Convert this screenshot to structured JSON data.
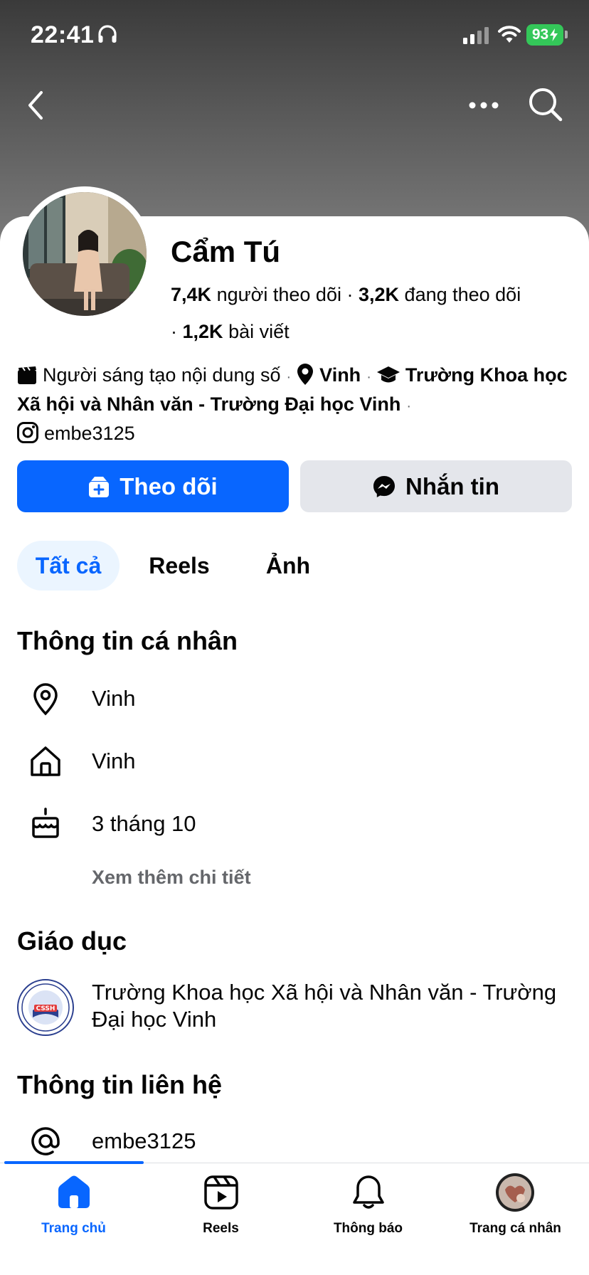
{
  "status_bar": {
    "time": "22:41",
    "battery": "93"
  },
  "header": {
    "back_icon": "chevron-left-icon",
    "more_icon": "more-horizontal-icon",
    "search_icon": "search-icon"
  },
  "profile": {
    "name": "Cẩm Tú",
    "followers_count": "7,4K",
    "followers_label": "người theo dõi",
    "following_count": "3,2K",
    "following_label": "đang theo dõi",
    "posts_count": "1,2K",
    "posts_label": "bài viết"
  },
  "intro": {
    "category": "Người sáng tạo nội dung số",
    "location": "Vinh",
    "school": "Trường Khoa học Xã hội và Nhân văn - Trường Đại học Vinh",
    "instagram": "embe3125"
  },
  "actions": {
    "follow_label": "Theo dõi",
    "message_label": "Nhắn tin"
  },
  "tabs": [
    {
      "label": "Tất cả",
      "active": true
    },
    {
      "label": "Reels",
      "active": false
    },
    {
      "label": "Ảnh",
      "active": false
    }
  ],
  "personal_info": {
    "title": "Thông tin cá nhân",
    "current_city": "Vinh",
    "hometown": "Vinh",
    "birthday": "3 tháng 10",
    "see_more": "Xem thêm chi tiết"
  },
  "education": {
    "title": "Giáo dục",
    "school": "Trường Khoa học Xã hội và Nhân văn - Trường Đại học Vinh",
    "logo_text": "CSSH"
  },
  "contact": {
    "title": "Thông tin liên hệ",
    "handle": "embe3125"
  },
  "bottom_nav": [
    {
      "label": "Trang chủ",
      "icon": "home-icon",
      "active": true
    },
    {
      "label": "Reels",
      "icon": "reels-icon",
      "active": false
    },
    {
      "label": "Thông báo",
      "icon": "bell-icon",
      "active": false
    },
    {
      "label": "Trang cá nhân",
      "icon": "profile-avatar-icon",
      "active": false
    }
  ],
  "colors": {
    "accent": "#0866ff",
    "tab_active_bg": "#ebf5ff",
    "secondary_button_bg": "#e4e6eb",
    "battery": "#34c759",
    "muted_text": "#65676b"
  }
}
